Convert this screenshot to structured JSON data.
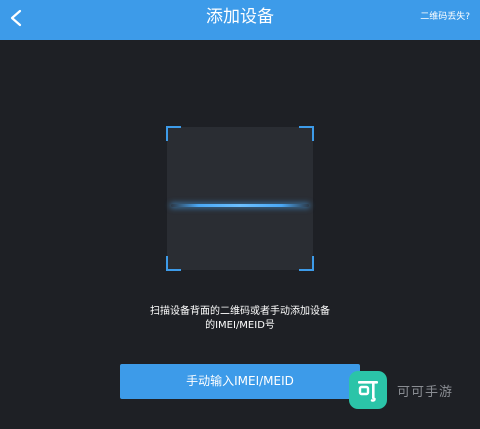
{
  "header": {
    "title": "添加设备",
    "help_link": "二维码丢失?",
    "back_icon": "chevron-left-icon"
  },
  "scanner": {
    "frame_color": "#3d9be9",
    "scan_line_color": "#4aa8f5"
  },
  "instruction": {
    "line1": "扫描设备背面的二维码或者手动添加设备",
    "line2": "的IMEI/MEID号"
  },
  "manual_button": {
    "label": "手动输入IMEI/MEID"
  },
  "watermark": {
    "text": "可可手游"
  },
  "colors": {
    "accent": "#3d9be9",
    "background": "#1e2025",
    "watermark_logo": "#2bc4a8"
  }
}
